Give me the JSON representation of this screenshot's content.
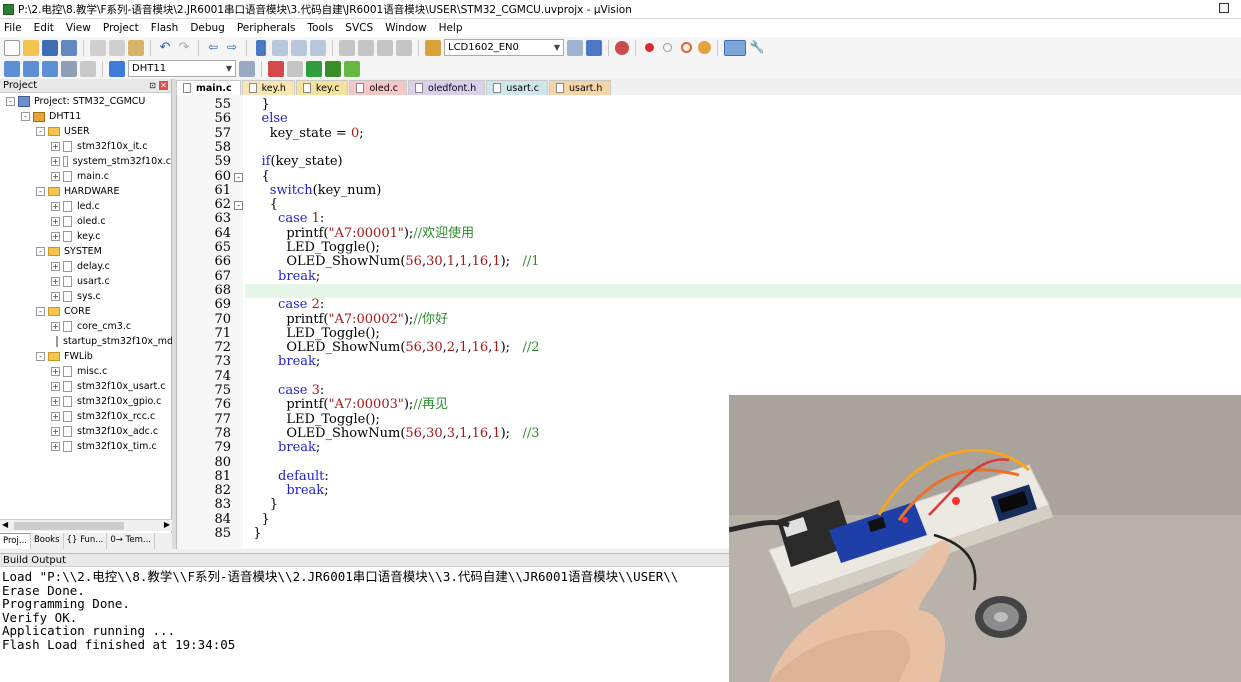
{
  "window": {
    "title": "P:\\2.电控\\8.教学\\F系列-语音模块\\2.JR6001串口语音模块\\3.代码自建\\JR6001语音模块\\USER\\STM32_CGMCU.uvprojx - µVision"
  },
  "menu": [
    "File",
    "Edit",
    "View",
    "Project",
    "Flash",
    "Debug",
    "Peripherals",
    "Tools",
    "SVCS",
    "Window",
    "Help"
  ],
  "toolbar1": {
    "find_combo": "LCD1602_EN0"
  },
  "toolbar2": {
    "target_combo": "DHT11"
  },
  "project_panel": {
    "title": "Project",
    "tree": [
      {
        "label": "Project: STM32_CGMCU",
        "kind": "project",
        "level": 0,
        "exp": "-"
      },
      {
        "label": "DHT11",
        "kind": "target",
        "level": 1,
        "exp": "-"
      },
      {
        "label": "USER",
        "kind": "folder",
        "level": 2,
        "exp": "-"
      },
      {
        "label": "stm32f10x_it.c",
        "kind": "file",
        "level": 3,
        "exp": "+"
      },
      {
        "label": "system_stm32f10x.c",
        "kind": "file",
        "level": 3,
        "exp": "+"
      },
      {
        "label": "main.c",
        "kind": "file",
        "level": 3,
        "exp": "+"
      },
      {
        "label": "HARDWARE",
        "kind": "folder",
        "level": 2,
        "exp": "-"
      },
      {
        "label": "led.c",
        "kind": "file",
        "level": 3,
        "exp": "+"
      },
      {
        "label": "oled.c",
        "kind": "file",
        "level": 3,
        "exp": "+"
      },
      {
        "label": "key.c",
        "kind": "file",
        "level": 3,
        "exp": "+"
      },
      {
        "label": "SYSTEM",
        "kind": "folder",
        "level": 2,
        "exp": "-"
      },
      {
        "label": "delay.c",
        "kind": "file",
        "level": 3,
        "exp": "+"
      },
      {
        "label": "usart.c",
        "kind": "file",
        "level": 3,
        "exp": "+"
      },
      {
        "label": "sys.c",
        "kind": "file",
        "level": 3,
        "exp": "+"
      },
      {
        "label": "CORE",
        "kind": "folder",
        "level": 2,
        "exp": "-"
      },
      {
        "label": "core_cm3.c",
        "kind": "file",
        "level": 3,
        "exp": "+"
      },
      {
        "label": "startup_stm32f10x_md",
        "kind": "file",
        "level": 3,
        "exp": ""
      },
      {
        "label": "FWLib",
        "kind": "folder",
        "level": 2,
        "exp": "-"
      },
      {
        "label": "misc.c",
        "kind": "file",
        "level": 3,
        "exp": "+"
      },
      {
        "label": "stm32f10x_usart.c",
        "kind": "file",
        "level": 3,
        "exp": "+"
      },
      {
        "label": "stm32f10x_gpio.c",
        "kind": "file",
        "level": 3,
        "exp": "+"
      },
      {
        "label": "stm32f10x_rcc.c",
        "kind": "file",
        "level": 3,
        "exp": "+"
      },
      {
        "label": "stm32f10x_adc.c",
        "kind": "file",
        "level": 3,
        "exp": "+"
      },
      {
        "label": "stm32f10x_tim.c",
        "kind": "file",
        "level": 3,
        "exp": "+"
      }
    ],
    "tabs": [
      {
        "label": "Proj...",
        "active": true
      },
      {
        "label": "Books",
        "active": false
      },
      {
        "label": "{} Fun...",
        "active": false
      },
      {
        "label": "0→ Tem...",
        "active": false
      }
    ]
  },
  "editor_tabs": [
    {
      "label": "main.c",
      "color": "#ffffff",
      "active": true
    },
    {
      "label": "key.h",
      "color": "#f9e6b3",
      "active": false
    },
    {
      "label": "key.c",
      "color": "#f3e39c",
      "active": false
    },
    {
      "label": "oled.c",
      "color": "#f7c6c6",
      "active": false
    },
    {
      "label": "oledfont.h",
      "color": "#d9d0f0",
      "active": false
    },
    {
      "label": "usart.c",
      "color": "#cfe6ea",
      "active": false
    },
    {
      "label": "usart.h",
      "color": "#f5d5a8",
      "active": false
    }
  ],
  "code": [
    {
      "n": "55",
      "fold": "",
      "segs": [
        [
          "t",
          "    }"
        ]
      ]
    },
    {
      "n": "56",
      "fold": "",
      "segs": [
        [
          "kw",
          "    else"
        ]
      ]
    },
    {
      "n": "57",
      "fold": "",
      "segs": [
        [
          "t",
          "      key_state = "
        ],
        [
          "num",
          "0"
        ],
        [
          "t",
          ";"
        ]
      ]
    },
    {
      "n": "58",
      "fold": "",
      "segs": []
    },
    {
      "n": "59",
      "fold": "",
      "segs": [
        [
          "kw",
          "    if"
        ],
        [
          "t",
          "(key_state)"
        ]
      ]
    },
    {
      "n": "60",
      "fold": "-",
      "segs": [
        [
          "t",
          "    {"
        ]
      ]
    },
    {
      "n": "61",
      "fold": "",
      "segs": [
        [
          "kw",
          "      switch"
        ],
        [
          "t",
          "(key_num)"
        ]
      ]
    },
    {
      "n": "62",
      "fold": "-",
      "segs": [
        [
          "t",
          "      {"
        ]
      ]
    },
    {
      "n": "63",
      "fold": "",
      "segs": [
        [
          "kw",
          "        case "
        ],
        [
          "num",
          "1"
        ],
        [
          "t",
          ":"
        ]
      ]
    },
    {
      "n": "64",
      "fold": "",
      "segs": [
        [
          "t",
          "          printf("
        ],
        [
          "str",
          "\"A7:00001\""
        ],
        [
          "t",
          ");"
        ],
        [
          "cm",
          "//欢迎使用"
        ]
      ]
    },
    {
      "n": "65",
      "fold": "",
      "segs": [
        [
          "t",
          "          LED_Toggle();"
        ]
      ]
    },
    {
      "n": "66",
      "fold": "",
      "segs": [
        [
          "t",
          "          OLED_ShowNum("
        ],
        [
          "num",
          "56"
        ],
        [
          "t",
          ","
        ],
        [
          "num",
          "30"
        ],
        [
          "t",
          ","
        ],
        [
          "num",
          "1"
        ],
        [
          "t",
          ","
        ],
        [
          "num",
          "1"
        ],
        [
          "t",
          ","
        ],
        [
          "num",
          "16"
        ],
        [
          "t",
          ","
        ],
        [
          "num",
          "1"
        ],
        [
          "t",
          ");   "
        ],
        [
          "cm",
          "//1"
        ]
      ]
    },
    {
      "n": "67",
      "fold": "",
      "segs": [
        [
          "kw",
          "        break"
        ],
        [
          "t",
          ";"
        ]
      ]
    },
    {
      "n": "68",
      "fold": "",
      "segs": [],
      "hl": true
    },
    {
      "n": "69",
      "fold": "",
      "segs": [
        [
          "kw",
          "        case "
        ],
        [
          "num",
          "2"
        ],
        [
          "t",
          ":"
        ]
      ]
    },
    {
      "n": "70",
      "fold": "",
      "segs": [
        [
          "t",
          "          printf("
        ],
        [
          "str",
          "\"A7:00002\""
        ],
        [
          "t",
          ");"
        ],
        [
          "cm",
          "//你好"
        ]
      ]
    },
    {
      "n": "71",
      "fold": "",
      "segs": [
        [
          "t",
          "          LED_Toggle();"
        ]
      ]
    },
    {
      "n": "72",
      "fold": "",
      "segs": [
        [
          "t",
          "          OLED_ShowNum("
        ],
        [
          "num",
          "56"
        ],
        [
          "t",
          ","
        ],
        [
          "num",
          "30"
        ],
        [
          "t",
          ","
        ],
        [
          "num",
          "2"
        ],
        [
          "t",
          ","
        ],
        [
          "num",
          "1"
        ],
        [
          "t",
          ","
        ],
        [
          "num",
          "16"
        ],
        [
          "t",
          ","
        ],
        [
          "num",
          "1"
        ],
        [
          "t",
          ");   "
        ],
        [
          "cm",
          "//2"
        ]
      ]
    },
    {
      "n": "73",
      "fold": "",
      "segs": [
        [
          "kw",
          "        break"
        ],
        [
          "t",
          ";"
        ]
      ]
    },
    {
      "n": "74",
      "fold": "",
      "segs": []
    },
    {
      "n": "75",
      "fold": "",
      "segs": [
        [
          "kw",
          "        case "
        ],
        [
          "num",
          "3"
        ],
        [
          "t",
          ":"
        ]
      ]
    },
    {
      "n": "76",
      "fold": "",
      "segs": [
        [
          "t",
          "          printf("
        ],
        [
          "str",
          "\"A7:00003\""
        ],
        [
          "t",
          ");"
        ],
        [
          "cm",
          "//再见"
        ]
      ]
    },
    {
      "n": "77",
      "fold": "",
      "segs": [
        [
          "t",
          "          LED_Toggle();"
        ]
      ]
    },
    {
      "n": "78",
      "fold": "",
      "segs": [
        [
          "t",
          "          OLED_ShowNum("
        ],
        [
          "num",
          "56"
        ],
        [
          "t",
          ","
        ],
        [
          "num",
          "30"
        ],
        [
          "t",
          ","
        ],
        [
          "num",
          "3"
        ],
        [
          "t",
          ","
        ],
        [
          "num",
          "1"
        ],
        [
          "t",
          ","
        ],
        [
          "num",
          "16"
        ],
        [
          "t",
          ","
        ],
        [
          "num",
          "1"
        ],
        [
          "t",
          ");   "
        ],
        [
          "cm",
          "//3"
        ]
      ]
    },
    {
      "n": "79",
      "fold": "",
      "segs": [
        [
          "kw",
          "        break"
        ],
        [
          "t",
          ";"
        ]
      ]
    },
    {
      "n": "80",
      "fold": "",
      "segs": []
    },
    {
      "n": "81",
      "fold": "",
      "segs": [
        [
          "kw",
          "        default"
        ],
        [
          "t",
          ":"
        ]
      ]
    },
    {
      "n": "82",
      "fold": "",
      "segs": [
        [
          "kw",
          "          break"
        ],
        [
          "t",
          ";"
        ]
      ]
    },
    {
      "n": "83",
      "fold": "",
      "segs": [
        [
          "t",
          "      }"
        ]
      ]
    },
    {
      "n": "84",
      "fold": "",
      "segs": [
        [
          "t",
          "    }"
        ]
      ]
    },
    {
      "n": "85",
      "fold": "",
      "segs": [
        [
          "t",
          "  }"
        ]
      ]
    }
  ],
  "build_output": {
    "title": "Build Output",
    "lines": [
      "Load \"P:\\\\2.电控\\\\8.教学\\\\F系列-语音模块\\\\2.JR6001串口语音模块\\\\3.代码自建\\\\JR6001语音模块\\\\USER\\\\",
      "Erase Done.",
      "Programming Done.",
      "Verify OK.",
      "Application running ...",
      "Flash Load finished at 19:34:05"
    ]
  }
}
